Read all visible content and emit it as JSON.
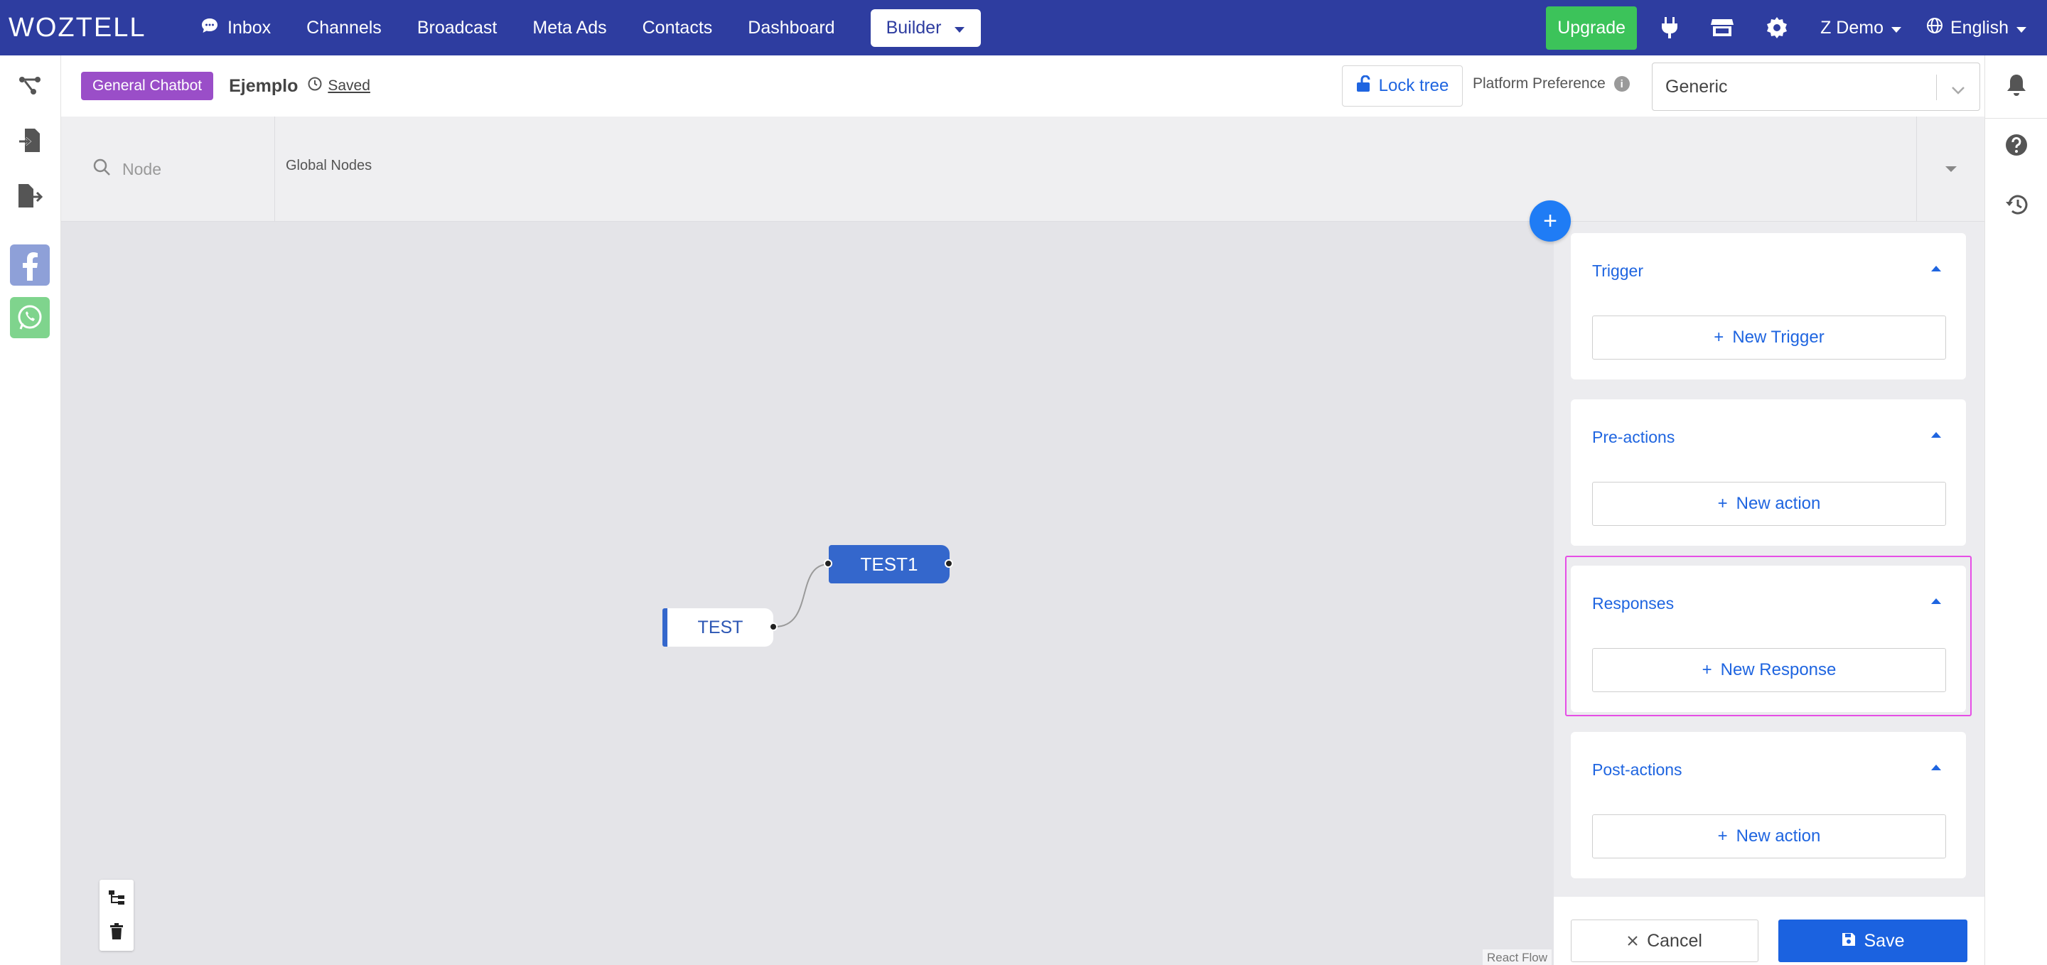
{
  "app": {
    "logo": "WOZTELL"
  },
  "nav": {
    "items": [
      {
        "label": "Inbox"
      },
      {
        "label": "Channels"
      },
      {
        "label": "Broadcast"
      },
      {
        "label": "Meta Ads"
      },
      {
        "label": "Contacts"
      },
      {
        "label": "Dashboard"
      }
    ],
    "builder": "Builder",
    "upgrade": "Upgrade",
    "account": "Z Demo",
    "language": "English"
  },
  "subheader": {
    "badge": "General Chatbot",
    "bot_name": "Ejemplo",
    "saved": "Saved",
    "lock": "Lock tree",
    "platform_label": "Platform Preference",
    "platform_value": "Generic"
  },
  "search": {
    "placeholder": "Node",
    "global_nodes": "Global Nodes"
  },
  "canvas": {
    "nodes": [
      {
        "label": "TEST"
      },
      {
        "label": "TEST1"
      }
    ],
    "attribution": "React Flow"
  },
  "panel": {
    "sections": [
      {
        "title": "Trigger",
        "button": "New Trigger"
      },
      {
        "title": "Pre-actions",
        "button": "New action"
      },
      {
        "title": "Responses",
        "button": "New Response"
      },
      {
        "title": "Post-actions",
        "button": "New action"
      }
    ],
    "cancel": "Cancel",
    "save": "Save"
  },
  "colors": {
    "nav_bg": "#2e3da0",
    "upgrade": "#3cc35a",
    "badge": "#9a4ec8",
    "primary": "#1f65e0",
    "node": "#3467cc",
    "highlight": "#e64ee6"
  }
}
